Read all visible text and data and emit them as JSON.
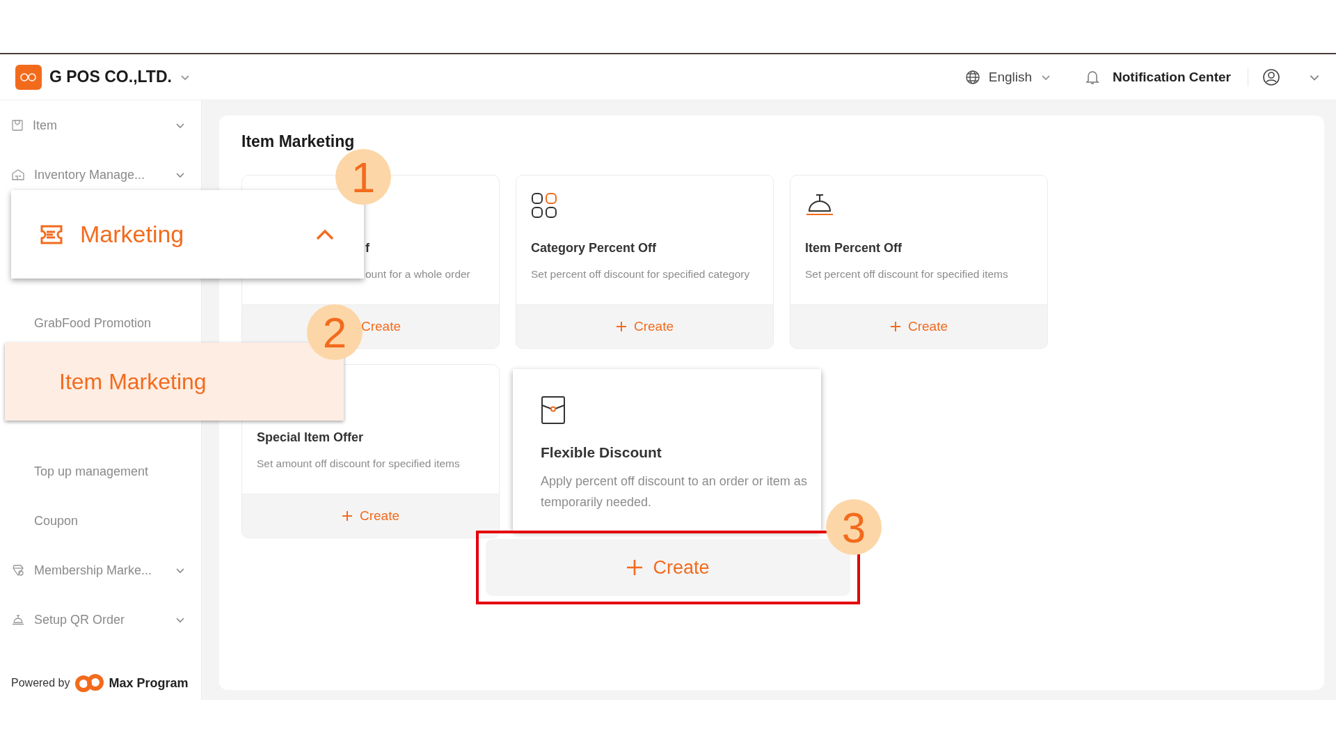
{
  "header": {
    "company": "G POS CO.,LTD.",
    "language": "English",
    "notifications": "Notification Center"
  },
  "sidebar": {
    "sections": [
      [
        {
          "label": "Item",
          "kind": "group",
          "expanded": false
        },
        {
          "label": "Inventory Manage...",
          "kind": "group",
          "expanded": false
        }
      ],
      [
        {
          "label": "GrabFood Promotion",
          "kind": "sub"
        }
      ],
      [
        {
          "label": "Top up management",
          "kind": "sub"
        },
        {
          "label": "Coupon",
          "kind": "sub"
        },
        {
          "label": "Membership Marke...",
          "kind": "group",
          "expanded": false
        },
        {
          "label": "Setup QR Order",
          "kind": "group",
          "expanded": false
        }
      ]
    ],
    "powered_by": "Powered by",
    "brand": "Max Program"
  },
  "page": {
    "title": "Item Marketing",
    "cards": [
      {
        "kind": "partial",
        "title": "f",
        "description": "ount for a whole order",
        "action": "Create",
        "plus_shown": false
      },
      {
        "kind": "full",
        "title": "Category Percent Off",
        "description": "Set percent off discount for specified category",
        "action": "Create",
        "plus_shown": true
      },
      {
        "kind": "full",
        "title": "Item Percent Off",
        "description": "Set percent off discount for specified items",
        "action": "Create",
        "plus_shown": true
      },
      {
        "kind": "full",
        "title": "Special Item Offer",
        "description": "Set amount off discount for specified items",
        "action": "Create",
        "plus_shown": true
      }
    ]
  },
  "callouts": {
    "menu": {
      "label": "Marketing",
      "expanded": true
    },
    "submenu": {
      "label": "Item Marketing",
      "selected": true
    },
    "card": {
      "title": "Flexible Discount",
      "description": "Apply percent off discount to an order or item as temporarily needed.",
      "action": "Create",
      "highlighted": true
    },
    "steps": [
      "1",
      "2",
      "3"
    ]
  }
}
